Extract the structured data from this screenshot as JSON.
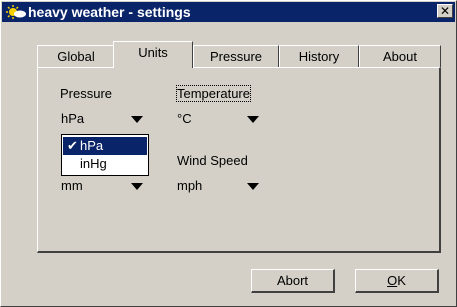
{
  "window": {
    "title": "heavy weather - settings",
    "close_label": "✕"
  },
  "tabs": [
    {
      "label": "Global"
    },
    {
      "label": "Units"
    },
    {
      "label": "Pressure"
    },
    {
      "label": "History"
    },
    {
      "label": "About"
    }
  ],
  "units": {
    "pressure": {
      "label": "Pressure",
      "value": "hPa"
    },
    "temperature": {
      "label": "Temperature",
      "value": "°C"
    },
    "rain": {
      "value": "mm"
    },
    "wind": {
      "label": "Wind Speed",
      "value": "mph"
    }
  },
  "pressure_dropdown": {
    "options": [
      {
        "label": "hPa",
        "check": "✔"
      },
      {
        "label": "inHg"
      }
    ]
  },
  "buttons": {
    "abort": "Abort",
    "ok_mnemonic": "O",
    "ok_rest": "K"
  }
}
